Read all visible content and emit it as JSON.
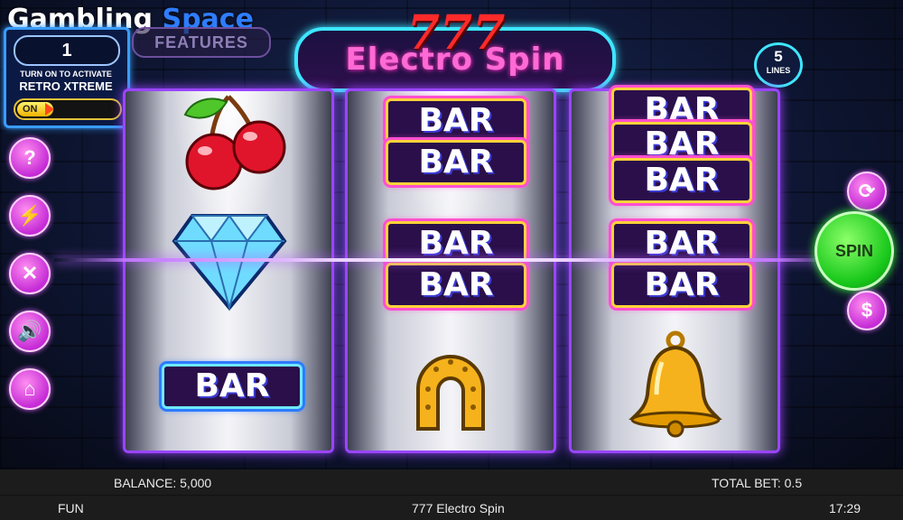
{
  "watermark": {
    "part1": "Gambling",
    "part2": "Space"
  },
  "retro": {
    "value": "1",
    "line1": "TURN ON TO ACTIVATE",
    "line2": "RETRO XTREME",
    "toggle": "ON"
  },
  "features_label": "FEATURES",
  "logo": {
    "number": "777",
    "name": "Electro Spin"
  },
  "lines": {
    "count": "5",
    "label": "LINES"
  },
  "reels": [
    {
      "symbols": [
        {
          "icon": "cherries-icon"
        },
        {
          "icon": "diamond-icon"
        },
        {
          "text": "BAR"
        }
      ]
    },
    {
      "symbols": [
        {
          "text": [
            "BAR",
            "BAR"
          ]
        },
        {
          "text": [
            "BAR",
            "BAR"
          ]
        },
        {
          "icon": "horseshoe-icon"
        }
      ]
    },
    {
      "symbols": [
        {
          "text": [
            "BAR",
            "BAR",
            "BAR"
          ]
        },
        {
          "text": [
            "BAR",
            "BAR"
          ]
        },
        {
          "icon": "bell-icon"
        }
      ]
    }
  ],
  "left_buttons": [
    {
      "name": "help-button",
      "icon": "question-icon",
      "glyph": "?"
    },
    {
      "name": "turbo-button",
      "icon": "lightning-off-icon",
      "glyph": "⚡"
    },
    {
      "name": "settings-button",
      "icon": "tools-icon",
      "glyph": "✕"
    },
    {
      "name": "sound-button",
      "icon": "speaker-icon",
      "glyph": "🔊"
    },
    {
      "name": "home-button",
      "icon": "home-icon",
      "glyph": "⌂"
    }
  ],
  "right_buttons": {
    "autoplay_glyph": "⟳",
    "spin": "SPIN",
    "bet_glyph": "$"
  },
  "footer": {
    "balance": "BALANCE: 5,000",
    "total_bet": "TOTAL BET: 0.5",
    "mode": "FUN",
    "game_title": "777 Electro Spin",
    "clock": "17:29"
  },
  "colors": {
    "reel_border": "#9a45ff",
    "bar_border": "#ffd23a",
    "bar_glow": "#ff4fd0",
    "spin_green": "#19c81b",
    "button_pink": "#c52bd6"
  }
}
